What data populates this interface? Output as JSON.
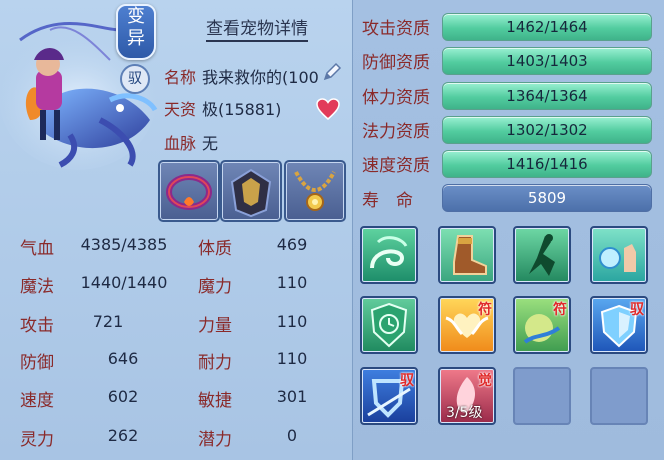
{
  "header": {
    "title": "查看宠物详情"
  },
  "pet": {
    "variant_badge": [
      "变",
      "异"
    ],
    "yu_badge": "驭",
    "name_label": "名称",
    "name_value": "我来救你的(100",
    "talent_label": "天资",
    "talent_value": "极(15881)",
    "blood_label": "血脉",
    "blood_value": "无"
  },
  "equipment": [
    "collar-red",
    "armor-dark",
    "necklace-gold"
  ],
  "stats": [
    {
      "label": "气血",
      "value": "4385/4385"
    },
    {
      "label": "魔法",
      "value": "1440/1440"
    },
    {
      "label": "攻击",
      "value": "721"
    },
    {
      "label": "防御",
      "value": "646"
    },
    {
      "label": "速度",
      "value": "602"
    },
    {
      "label": "灵力",
      "value": "262"
    }
  ],
  "attributes": [
    {
      "label": "体质",
      "value": "469"
    },
    {
      "label": "魔力",
      "value": "110"
    },
    {
      "label": "力量",
      "value": "110"
    },
    {
      "label": "耐力",
      "value": "110"
    },
    {
      "label": "敏捷",
      "value": "301"
    },
    {
      "label": "潜力",
      "value": "0"
    }
  ],
  "aptitudes": [
    {
      "label": "攻击资质",
      "value": "1462/1464",
      "fill": 0.999
    },
    {
      "label": "防御资质",
      "value": "1403/1403",
      "fill": 1
    },
    {
      "label": "体力资质",
      "value": "1364/1364",
      "fill": 1
    },
    {
      "label": "法力资质",
      "value": "1302/1302",
      "fill": 1
    },
    {
      "label": "速度资质",
      "value": "1416/1416",
      "fill": 1
    }
  ],
  "lifespan": {
    "label": "寿　命",
    "value": "5809"
  },
  "skills": [
    {
      "icon": "wind-swirl-icon",
      "tag": ""
    },
    {
      "icon": "boot-icon",
      "tag": ""
    },
    {
      "icon": "dash-figure-icon",
      "tag": ""
    },
    {
      "icon": "water-hand-icon",
      "tag": ""
    },
    {
      "icon": "clock-shield-icon",
      "tag": ""
    },
    {
      "icon": "wings-heart-icon",
      "tag": "符"
    },
    {
      "icon": "green-splash-icon",
      "tag": "符"
    },
    {
      "icon": "blue-shield-icon",
      "tag": "驭"
    },
    {
      "icon": "shield-slash-icon",
      "tag": "驭"
    },
    {
      "icon": "awaken-spirit-icon",
      "tag": "觉",
      "level": "3/5级"
    },
    {
      "icon": "empty",
      "tag": ""
    },
    {
      "icon": "empty",
      "tag": ""
    }
  ]
}
